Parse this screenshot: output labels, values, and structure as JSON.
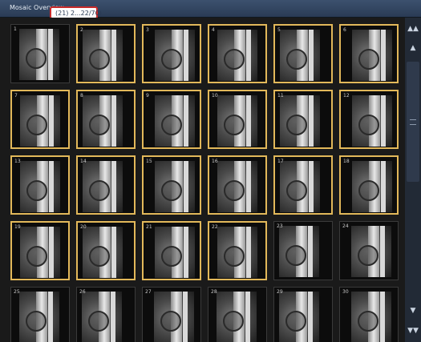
{
  "window": {
    "title": "Mosaic Overview",
    "count_label": "(21) 2...22/70)"
  },
  "tiles": [
    {
      "number": "1",
      "selected": false
    },
    {
      "number": "2",
      "selected": true
    },
    {
      "number": "3",
      "selected": true
    },
    {
      "number": "4",
      "selected": true
    },
    {
      "number": "5",
      "selected": true
    },
    {
      "number": "6",
      "selected": true
    },
    {
      "number": "7",
      "selected": true
    },
    {
      "number": "8",
      "selected": true
    },
    {
      "number": "9",
      "selected": true
    },
    {
      "number": "10",
      "selected": true
    },
    {
      "number": "11",
      "selected": true
    },
    {
      "number": "12",
      "selected": true
    },
    {
      "number": "13",
      "selected": true
    },
    {
      "number": "14",
      "selected": true
    },
    {
      "number": "15",
      "selected": true
    },
    {
      "number": "16",
      "selected": true
    },
    {
      "number": "17",
      "selected": true
    },
    {
      "number": "18",
      "selected": true
    },
    {
      "number": "19",
      "selected": true
    },
    {
      "number": "20",
      "selected": true
    },
    {
      "number": "21",
      "selected": true
    },
    {
      "number": "22",
      "selected": true
    },
    {
      "number": "23",
      "selected": false
    },
    {
      "number": "24",
      "selected": false
    },
    {
      "number": "25",
      "selected": false
    },
    {
      "number": "26",
      "selected": false
    },
    {
      "number": "27",
      "selected": false
    },
    {
      "number": "28",
      "selected": false
    },
    {
      "number": "29",
      "selected": false
    },
    {
      "number": "30",
      "selected": false
    }
  ],
  "scrollbar": {
    "top_icon": "double-up-arrow-icon",
    "up_icon": "up-arrow-icon",
    "grip_icon": "grip-icon",
    "down_icon": "down-arrow-icon",
    "bottom_icon": "double-down-arrow-icon"
  },
  "colors": {
    "selection_border": "#e2b85a",
    "highlight_box": "#c82a2a",
    "titlebar": "#2a3b55"
  }
}
